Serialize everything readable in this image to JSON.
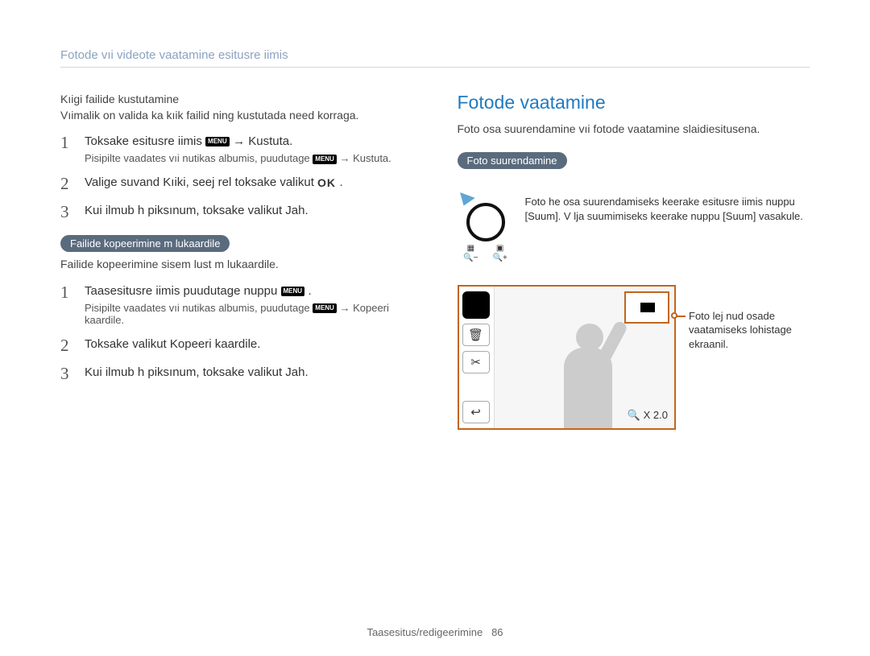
{
  "breadcrumb": "Fotode vıi videote vaatamine esitusre iimis",
  "left": {
    "intro1": "Kıigi failide kustutamine",
    "intro2": "Vıimalik on valida ka kıik failid ning kustutada need korraga.",
    "steps_a": [
      {
        "num": "1",
        "text_pre": "Toksake esitusre iimis ",
        "icon_label": "MENU",
        "arrow": " → ",
        "text_post": "Kustuta.",
        "sub_pre": "Pisipilte vaadates vıi nutikas albumis, puudutage ",
        "sub_post": " → Kustuta."
      },
      {
        "num": "2",
        "text_pre": "Valige suvand Kıiki, seej rel toksake valikut ",
        "icon_label": "OK",
        "text_post": "."
      },
      {
        "num": "3",
        "text_pre": "Kui ilmub h piksınum, toksake valikut ",
        "text_post": "Jah."
      }
    ],
    "pill_copy": "Failide kopeerimine m lukaardile",
    "copy_intro": "Failide kopeerimine sisem lust m lukaardile.",
    "steps_b": [
      {
        "num": "1",
        "text_pre": "Taasesitusre iimis puudutage nuppu ",
        "icon_label": "MENU",
        "text_post": ".",
        "sub_pre": "Pisipilte vaadates vıi nutikas albumis, puudutage ",
        "sub_post": " → Kopeeri kaardile."
      },
      {
        "num": "2",
        "text_pre": "Toksake valikut Kopeeri kaardile.",
        "text_post": ""
      },
      {
        "num": "3",
        "text_pre": "Kui ilmub h piksınum, toksake valikut ",
        "text_post": "Jah."
      }
    ]
  },
  "right": {
    "heading": "Fotode vaatamine",
    "intro": "Foto osa suurendamine vıi fotode vaatamine slaidiesitusena.",
    "pill_zoom": "Foto suurendamine",
    "dial_text": "Foto  he osa suurendamiseks keerake esitusre iimis nuppu [Suum]. V lja suumimiseks keerake nuppu [Suum] vasakule.",
    "zoom_value": "X 2.0",
    "callout": "Foto  lej  nud osade vaatamiseks lohistage ekraanil.",
    "ind_left_top": "▦",
    "ind_left_bot": "🔍−",
    "ind_right_top": "▣",
    "ind_right_bot": "🔍+"
  },
  "footer": {
    "section": "Taasesitus/redigeerimine",
    "page": "86"
  },
  "icons": {
    "menu": "MENU",
    "trash": "🗑",
    "scissors": "✂",
    "back": "↩"
  }
}
